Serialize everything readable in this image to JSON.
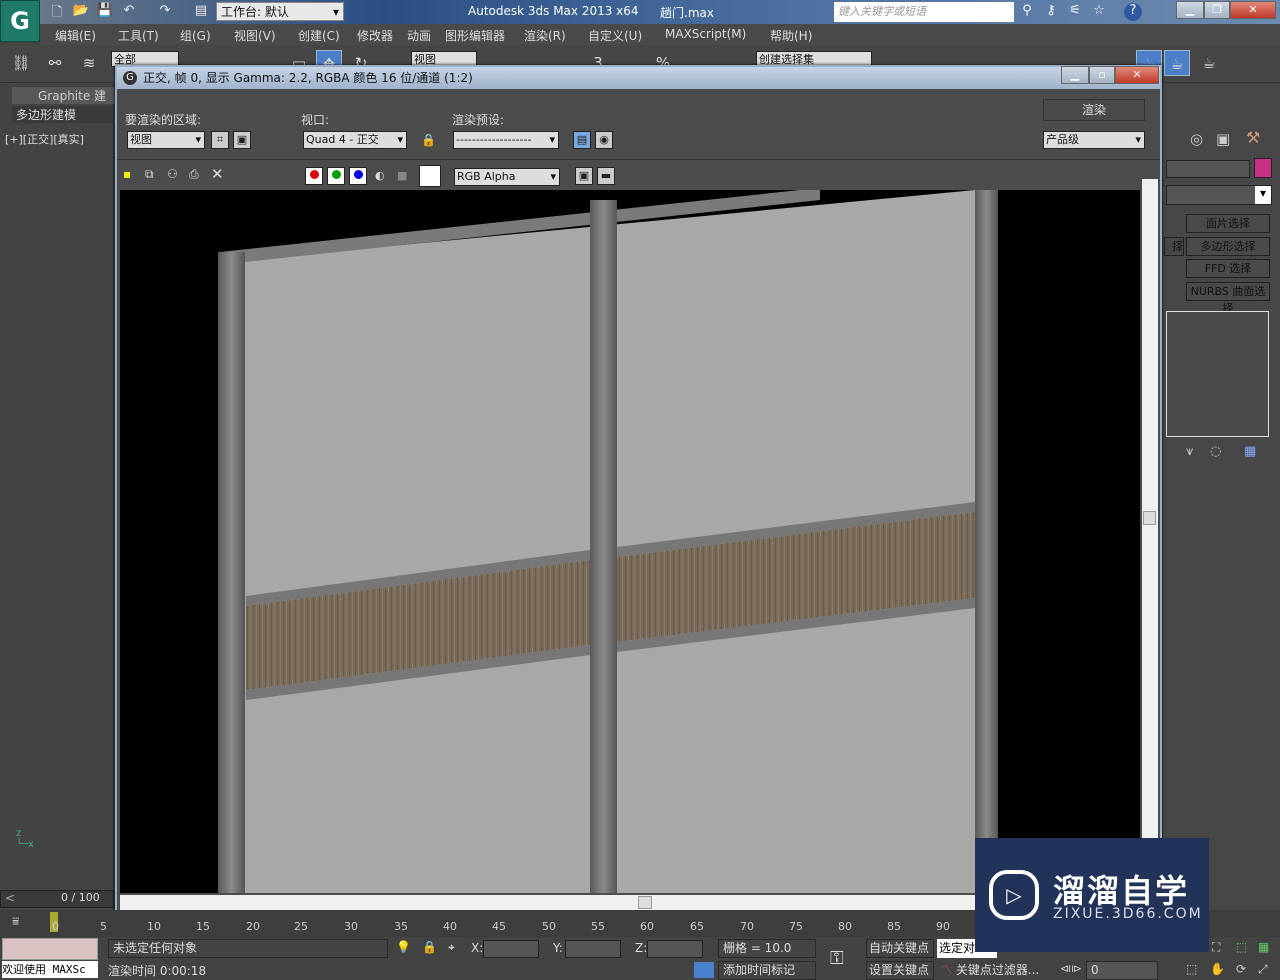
{
  "app": {
    "title": "Autodesk 3ds Max  2013 x64",
    "file": "趟门.max",
    "workspace": "工作台: 默认",
    "search_placeholder": "键入关键字或短语"
  },
  "menus": [
    "编辑(E)",
    "工具(T)",
    "组(G)",
    "视图(V)",
    "创建(C)",
    "修改器",
    "动画",
    "图形编辑器",
    "渲染(R)",
    "自定义(U)",
    "MAXScript(M)",
    "帮助(H)"
  ],
  "toolbar": {
    "filter": "全部",
    "refcoord": "视图",
    "selset": "创建选择集",
    "snap": "3",
    "percent": "%"
  },
  "left": {
    "ribbon_tab": "Graphite 建模",
    "poly_tab": "多边形建模",
    "viewport_label": "[+][正交][真实]",
    "frame_counter": "0 / 100"
  },
  "dialog": {
    "title": "正交, 帧 0, 显示 Gamma: 2.2, RGBA 颜色 16 位/通道 (1:2)",
    "area_label": "要渲染的区域:",
    "area_value": "视图",
    "viewport_label": "视口:",
    "viewport_value": "Quad 4 - 正交",
    "preset_label": "渲染预设:",
    "preset_value": "-------------------",
    "render_button": "渲染",
    "quality_value": "产品级",
    "channel_value": "RGB Alpha",
    "colors": {
      "red": "#e00000",
      "green": "#00a000",
      "blue": "#0000e0"
    }
  },
  "command_panel": {
    "buttons": [
      "面片选择",
      "多边形选择",
      "FFD 选择",
      "NURBS 曲面选择"
    ],
    "partial_label": "择",
    "color_swatch": "#c8308a"
  },
  "timeline": {
    "ticks": [
      "0",
      "5",
      "10",
      "15",
      "20",
      "25",
      "30",
      "35",
      "40",
      "45",
      "50",
      "55",
      "60",
      "65",
      "70",
      "75",
      "80",
      "85",
      "90"
    ]
  },
  "status": {
    "welcome": "欢迎使用 MAXSc",
    "selection": "未选定任何对象",
    "render_time": "渲染时间 0:00:18",
    "x_label": "X:",
    "y_label": "Y:",
    "z_label": "Z:",
    "grid": "栅格 = 10.0",
    "add_time_tag": "添加时间标记",
    "auto_key": "自动关键点",
    "set_key": "设置关键点",
    "selected": "选定对",
    "key_filter": "关键点过滤器...",
    "frame": "0"
  },
  "watermark": {
    "brand": "溜溜自学",
    "url": "ZIXUE.3D66.COM"
  }
}
